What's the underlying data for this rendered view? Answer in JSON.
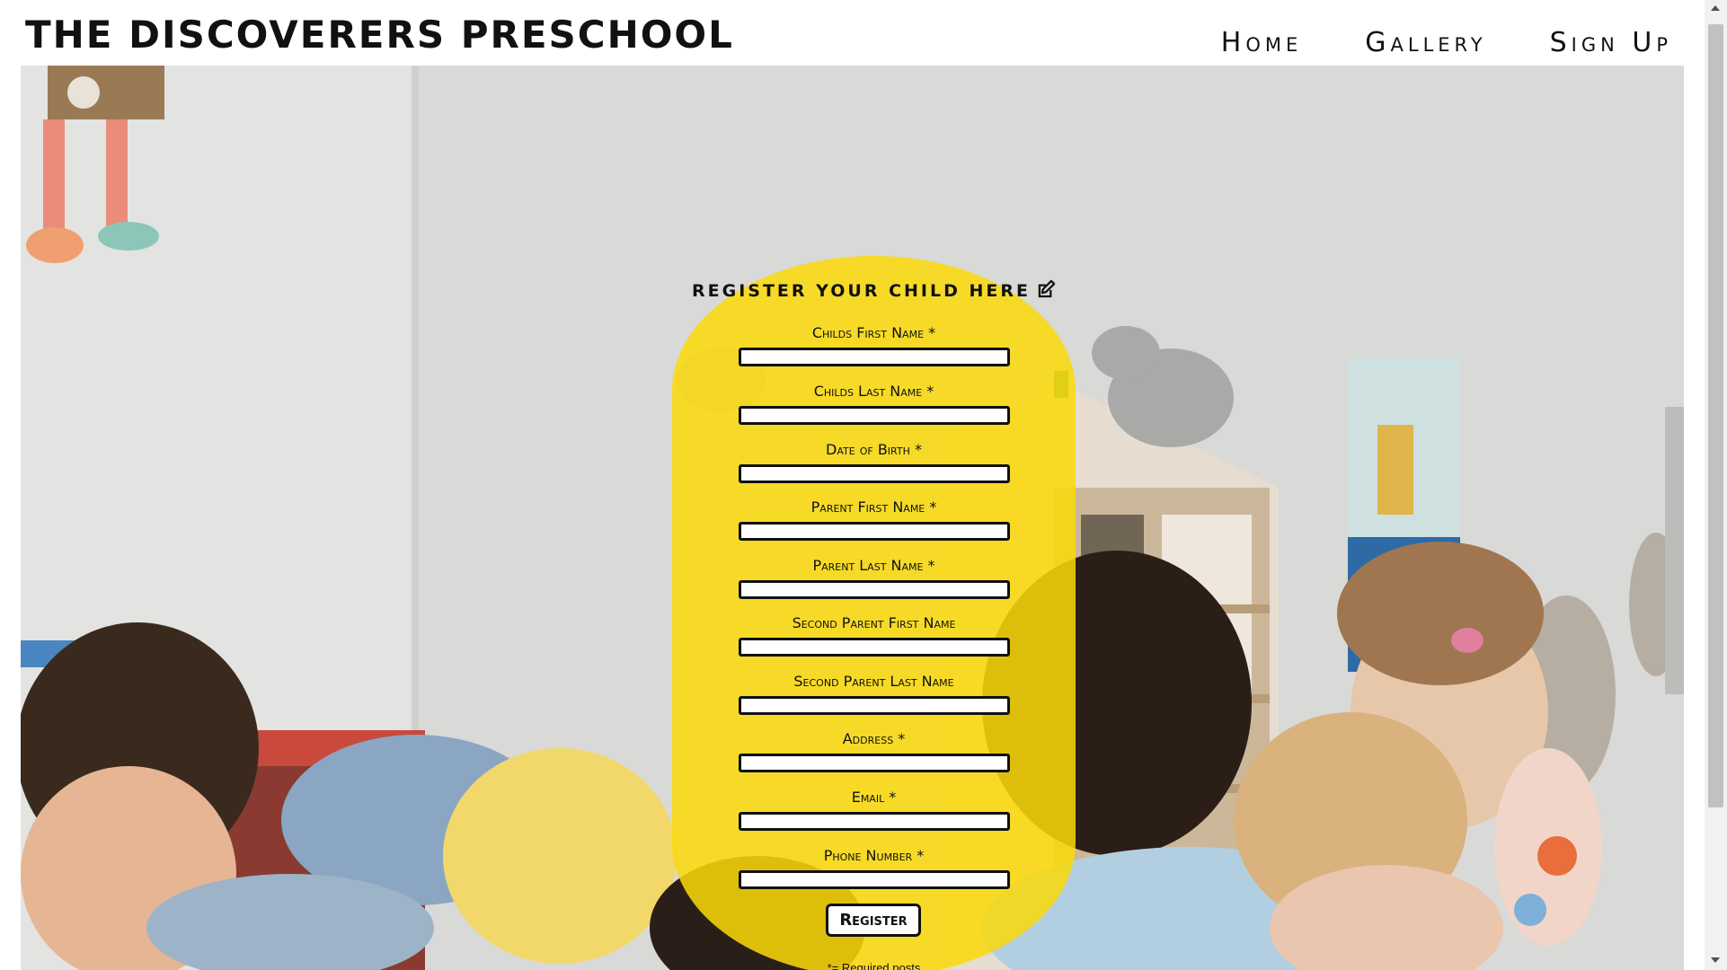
{
  "header": {
    "site_title": "THE DISCOVERERS PRESCHOOL",
    "nav": [
      {
        "label": "Home"
      },
      {
        "label": "Gallery"
      },
      {
        "label": "Sign Up"
      }
    ]
  },
  "form": {
    "title": "REGISTER YOUR CHILD HERE",
    "title_icon": "edit-icon",
    "fields": [
      {
        "label": "Childs First Name *",
        "value": ""
      },
      {
        "label": "Childs Last Name *",
        "value": ""
      },
      {
        "label": "Date of Birth *",
        "value": ""
      },
      {
        "label": "Parent First Name *",
        "value": ""
      },
      {
        "label": "Parent Last Name *",
        "value": ""
      },
      {
        "label": "Second Parent First Name",
        "value": ""
      },
      {
        "label": "Second Parent Last Name",
        "value": ""
      },
      {
        "label": "Address *",
        "value": ""
      },
      {
        "label": "Email *",
        "value": ""
      },
      {
        "label": "Phone Number *",
        "value": ""
      }
    ],
    "submit_label": "Register",
    "required_note": "*= Required posts"
  },
  "colors": {
    "panel_yellow": "#fada09",
    "text": "#111111",
    "hero_wall": "#d6d6d4"
  }
}
